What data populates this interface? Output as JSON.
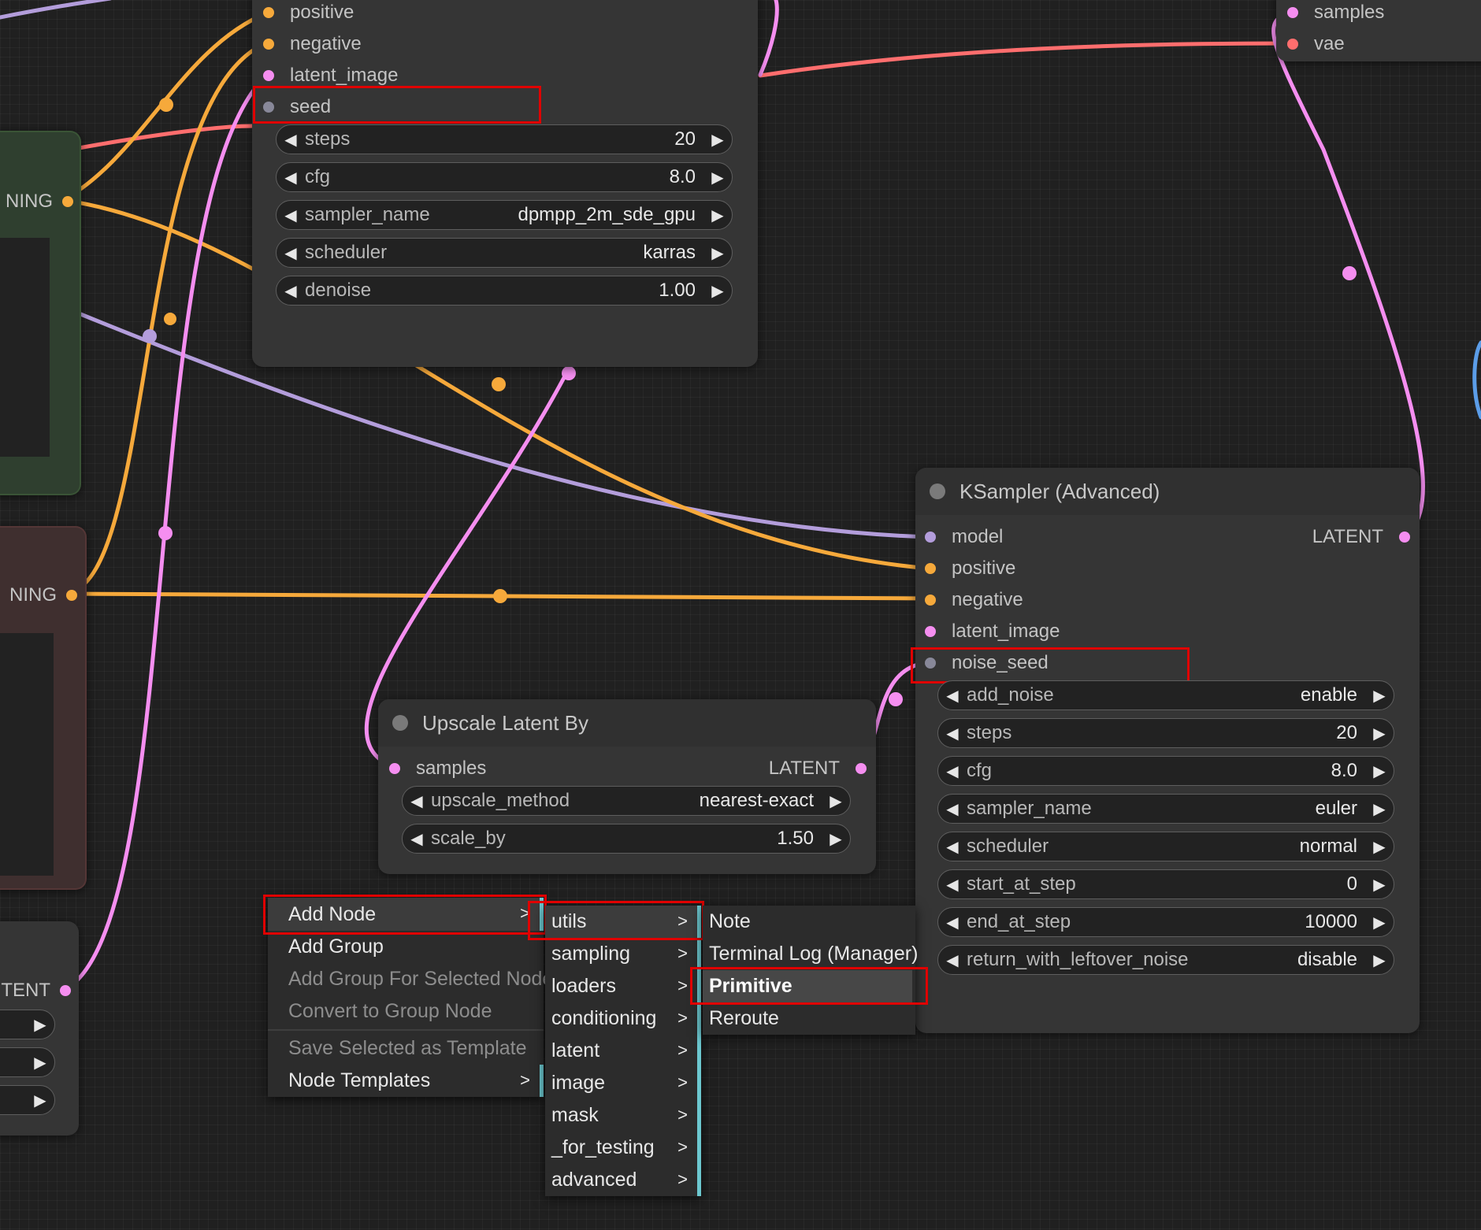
{
  "ksampler_top": {
    "inputs": [
      "positive",
      "negative",
      "latent_image",
      "seed"
    ],
    "widgets": [
      {
        "label": "steps",
        "value": "20"
      },
      {
        "label": "cfg",
        "value": "8.0"
      },
      {
        "label": "sampler_name",
        "value": "dpmpp_2m_sde_gpu"
      },
      {
        "label": "scheduler",
        "value": "karras"
      },
      {
        "label": "denoise",
        "value": "1.00"
      }
    ]
  },
  "vae_decode": {
    "inputs": [
      "samples",
      "vae"
    ]
  },
  "left_nodes": {
    "positive_output": "NING",
    "negative_output": "NING",
    "latent_output": "TENT"
  },
  "ksampler_advanced": {
    "title": "KSampler (Advanced)",
    "inputs": [
      "model",
      "positive",
      "negative",
      "latent_image",
      "noise_seed"
    ],
    "output": "LATENT",
    "widgets": [
      {
        "label": "add_noise",
        "value": "enable"
      },
      {
        "label": "steps",
        "value": "20"
      },
      {
        "label": "cfg",
        "value": "8.0"
      },
      {
        "label": "sampler_name",
        "value": "euler"
      },
      {
        "label": "scheduler",
        "value": "normal"
      },
      {
        "label": "start_at_step",
        "value": "0"
      },
      {
        "label": "end_at_step",
        "value": "10000"
      },
      {
        "label": "return_with_leftover_noise",
        "value": "disable"
      }
    ]
  },
  "upscale_latent": {
    "title": "Upscale Latent By",
    "input": "samples",
    "output": "LATENT",
    "widgets": [
      {
        "label": "upscale_method",
        "value": "nearest-exact"
      },
      {
        "label": "scale_by",
        "value": "1.50"
      }
    ]
  },
  "context_menu": {
    "items": [
      "Add Node",
      "Add Group",
      "Add Group For Selected Nodes",
      "Convert to Group Node",
      "Save Selected as Template",
      "Node Templates"
    ],
    "submenu_chevron": ">"
  },
  "category_menu": {
    "items": [
      "utils",
      "sampling",
      "loaders",
      "conditioning",
      "latent",
      "image",
      "mask",
      "_for_testing",
      "advanced"
    ]
  },
  "utils_menu": {
    "items": [
      "Note",
      "Terminal Log (Manager)",
      "Primitive",
      "Reroute"
    ]
  },
  "colors": {
    "conditioning": "#f6a93b",
    "latent": "#f58ef0",
    "model": "#b39ddb",
    "vae": "#ff6e6e",
    "int": "#888899",
    "highlight": "#e00000"
  }
}
